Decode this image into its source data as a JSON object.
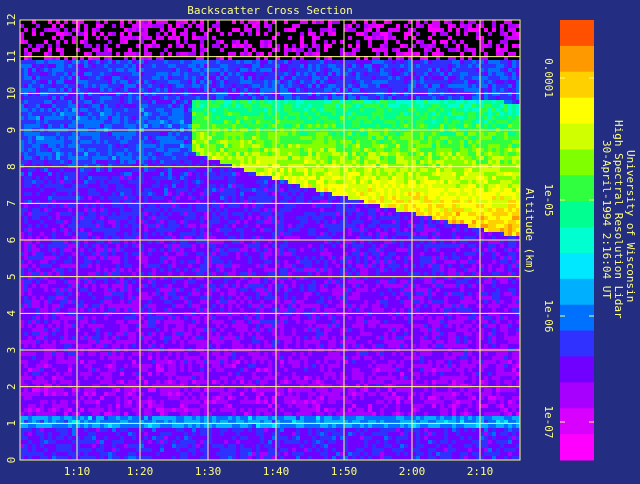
{
  "chart_data": {
    "type": "heatmap",
    "title": "Backscatter Cross Section",
    "xlabel": "",
    "ylabel": "Altitude (km)",
    "x_ticks": [
      "1:10",
      "1:20",
      "1:30",
      "1:40",
      "1:50",
      "2:00",
      "2:10"
    ],
    "y_ticks": [
      "0",
      "1",
      "2",
      "3",
      "4",
      "5",
      "6",
      "7",
      "8",
      "9",
      "10",
      "11",
      "12"
    ],
    "ylim": [
      0,
      12
    ],
    "grid": true,
    "colorbar": {
      "scale": "log",
      "tick_labels": [
        "0.0001",
        "1e-05",
        "1e-06",
        "1e-07"
      ],
      "colors": [
        "#ff5000",
        "#ff9900",
        "#ffd000",
        "#ffff00",
        "#d0ff00",
        "#80ff00",
        "#30ff40",
        "#00ff90",
        "#00ffd0",
        "#00e8ff",
        "#00b0ff",
        "#0070ff",
        "#3030ff",
        "#7000ff",
        "#a800ff",
        "#d800ff",
        "#ff00ff"
      ]
    },
    "features": {
      "cloud_layer": {
        "top_km": 9.9,
        "base_km_start": 8.7,
        "base_km_end": 6.1
      },
      "boundary_layer_top_km": 1.2,
      "background": "#232d82"
    }
  },
  "annotation": {
    "line1": "University of Wisconsin",
    "line2": "High Spectral Resolution Lidar",
    "line3": "30-April-1994  2:16:04 UT"
  }
}
